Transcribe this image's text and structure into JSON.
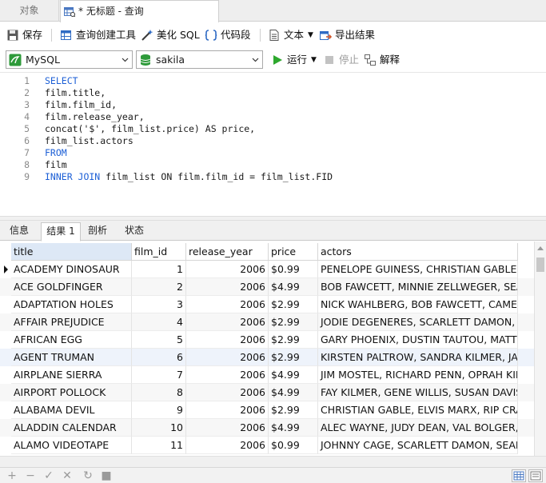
{
  "tabs": {
    "objects": "对象",
    "query": "* 无标题 - 查询"
  },
  "toolbar": {
    "save": "保存",
    "query_builder": "查询创建工具",
    "beautify": "美化 SQL",
    "snippet": "代码段",
    "text": "文本",
    "export": "导出结果"
  },
  "toolbar2": {
    "connection": "MySQL",
    "database": "sakila",
    "run": "运行",
    "stop": "停止",
    "explain": "解释"
  },
  "editor": {
    "lines": [
      {
        "n": "1",
        "kw": "SELECT",
        "rest": ""
      },
      {
        "n": "2",
        "kw": "",
        "rest": "film.title,"
      },
      {
        "n": "3",
        "kw": "",
        "rest": "film.film_id,"
      },
      {
        "n": "4",
        "kw": "",
        "rest": "film.release_year,"
      },
      {
        "n": "5",
        "kw": "",
        "rest": "concat('$', film_list.price) AS price,"
      },
      {
        "n": "6",
        "kw": "",
        "rest": "film_list.actors"
      },
      {
        "n": "7",
        "kw": "FROM",
        "rest": ""
      },
      {
        "n": "8",
        "kw": "",
        "rest": "film"
      },
      {
        "n": "9",
        "kw": "INNER JOIN",
        "rest": " film_list ON film.film_id = film_list.FID"
      }
    ]
  },
  "result_tabs": [
    "信息",
    "结果 1",
    "剖析",
    "状态"
  ],
  "grid": {
    "columns": [
      "title",
      "film_id",
      "release_year",
      "price",
      "actors"
    ],
    "rows": [
      [
        "ACADEMY DINOSAUR",
        "1",
        "2006",
        "$0.99",
        "PENELOPE GUINESS, CHRISTIAN GABLE, L"
      ],
      [
        "ACE GOLDFINGER",
        "2",
        "2006",
        "$4.99",
        "BOB FAWCETT, MINNIE ZELLWEGER, SEAN"
      ],
      [
        "ADAPTATION HOLES",
        "3",
        "2006",
        "$2.99",
        "NICK WAHLBERG, BOB FAWCETT, CAMERO"
      ],
      [
        "AFFAIR PREJUDICE",
        "4",
        "2006",
        "$2.99",
        "JODIE DEGENERES, SCARLETT DAMON, KI"
      ],
      [
        "AFRICAN EGG",
        "5",
        "2006",
        "$2.99",
        "GARY PHOENIX, DUSTIN TAUTOU, MATTH"
      ],
      [
        "AGENT TRUMAN",
        "6",
        "2006",
        "$2.99",
        "KIRSTEN PALTROW, SANDRA KILMER, JAY"
      ],
      [
        "AIRPLANE SIERRA",
        "7",
        "2006",
        "$4.99",
        "JIM MOSTEL, RICHARD PENN, OPRAH KIL"
      ],
      [
        "AIRPORT POLLOCK",
        "8",
        "2006",
        "$4.99",
        "FAY KILMER, GENE WILLIS, SUSAN DAVIS,"
      ],
      [
        "ALABAMA DEVIL",
        "9",
        "2006",
        "$2.99",
        "CHRISTIAN GABLE, ELVIS MARX, RIP CRAW"
      ],
      [
        "ALADDIN CALENDAR",
        "10",
        "2006",
        "$4.99",
        "ALEC WAYNE, JUDY DEAN, VAL BOLGER, R"
      ],
      [
        "ALAMO VIDEOTAPE",
        "11",
        "2006",
        "$0.99",
        "JOHNNY CAGE, SCARLETT DAMON, SEAN"
      ]
    ]
  },
  "colors": {
    "keyword": "#1c5fd6",
    "run_green": "#2ea82e",
    "selected_header": "#dde8f6"
  }
}
